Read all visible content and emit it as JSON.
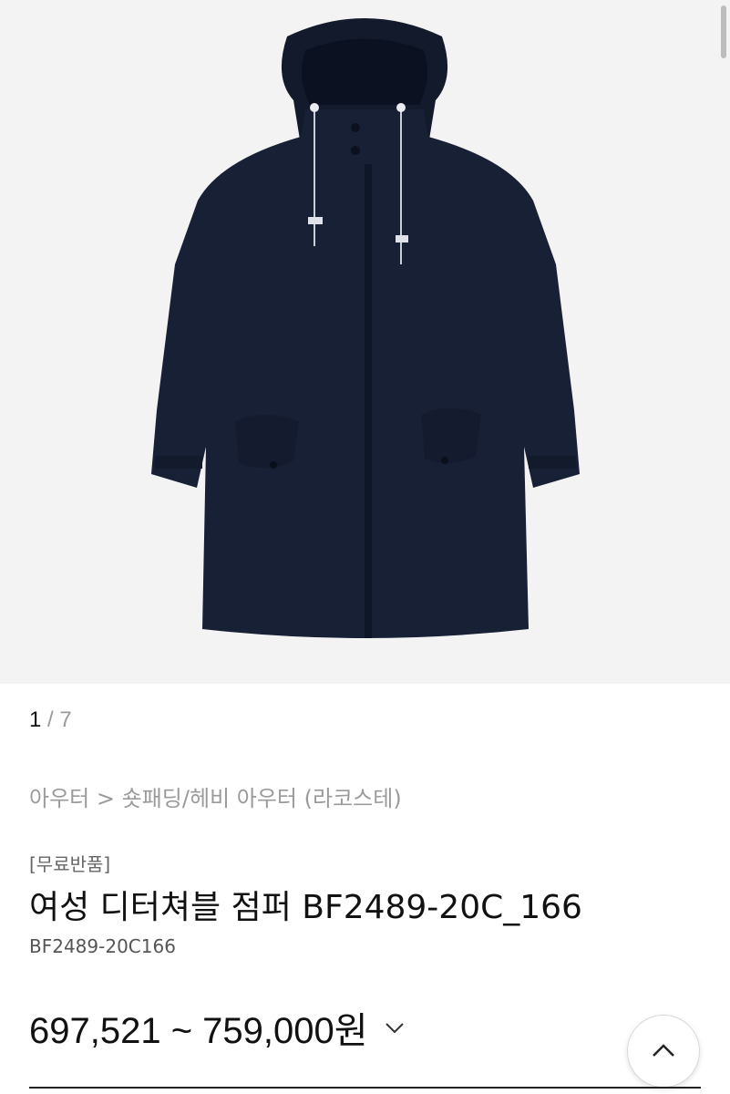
{
  "gallery": {
    "current": "1",
    "separator": "/",
    "total": "7",
    "image_icon": "coat-product-image"
  },
  "breadcrumb": {
    "category": "아우터",
    "arrow": ">",
    "subcategory": "숏패딩/헤비 아우터",
    "brand": "(라코스테)"
  },
  "product": {
    "tag": "[무료반품]",
    "name": "여성 디터쳐블 점퍼 BF2489-20C_166",
    "code": "BF2489-20C166",
    "price": "697,521 ~ 759,000원",
    "price_dropdown_icon": "chevron-down-icon"
  },
  "scroll_top_button": {
    "icon": "chevron-up-icon"
  }
}
